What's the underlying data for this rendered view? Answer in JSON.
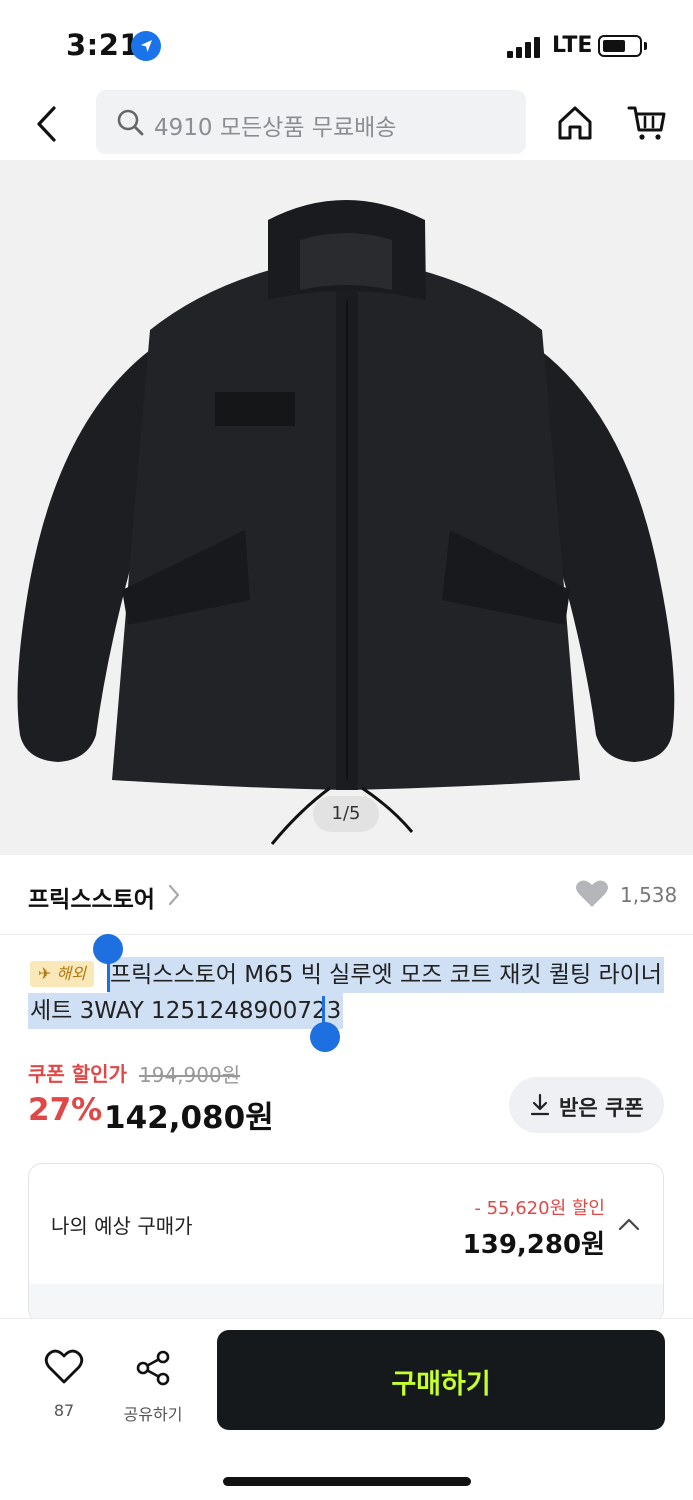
{
  "status_bar": {
    "time": "3:21",
    "network": "LTE"
  },
  "header": {
    "search_placeholder": "4910 모든상품 무료배송",
    "icons": [
      "back-icon",
      "search-icon",
      "home-icon",
      "cart-icon"
    ]
  },
  "gallery": {
    "counter": "1/5"
  },
  "store": {
    "name": "프릭스스토어",
    "like_count": "1,538"
  },
  "product": {
    "badge": "해외",
    "title_line1": "프릭스스토어 M65 빅 실루엣 모즈 코트 재킷 퀼팅 라이너",
    "title_line2": "세트 3WAY 1251248900723"
  },
  "price": {
    "coupon_label": "쿠폰 할인가",
    "original_price": "194,900원",
    "discount_rate": "27%",
    "sale_price": "142,080원",
    "coupon_button": "받은 쿠폰"
  },
  "expected": {
    "label": "나의 예상 구매가",
    "discount": "- 55,620원 할인",
    "price": "139,280원"
  },
  "bottom_bar": {
    "wish_count": "87",
    "share_label": "공유하기",
    "buy_label": "구매하기"
  },
  "colors": {
    "accent_red": "#e04848",
    "buy_button_bg": "#16191c",
    "buy_button_text": "#c7ff2e",
    "selection": "#1e6fe0"
  }
}
